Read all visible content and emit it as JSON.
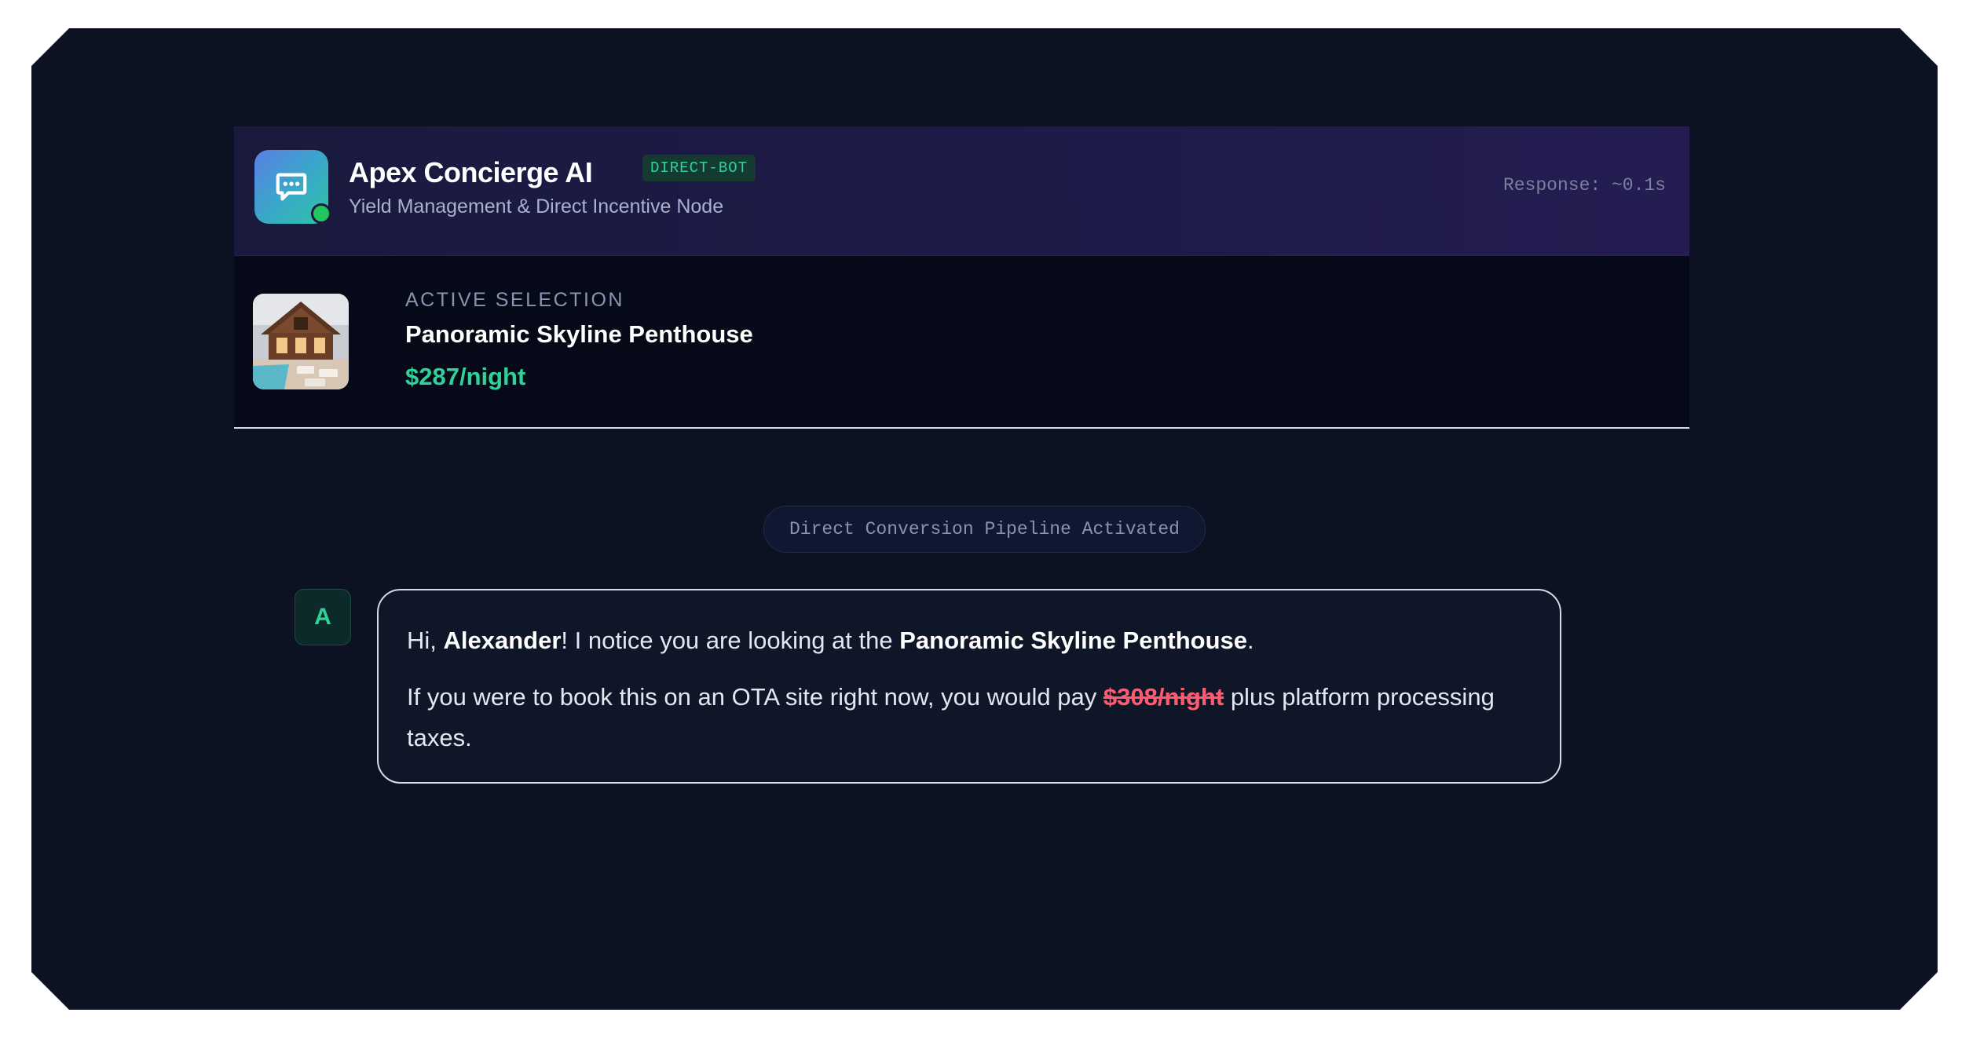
{
  "header": {
    "bot_name": "Apex Concierge AI",
    "badge": "DIRECT-BOT",
    "subtitle": "Yield Management & Direct Incentive Node",
    "response_time": "Response: ~0.1s",
    "status": "online",
    "icon": "chat-bubble-icon"
  },
  "selection": {
    "label": "ACTIVE SELECTION",
    "title": "Panoramic Skyline Penthouse",
    "price": "$287/night",
    "thumbnail": "property-photo"
  },
  "pipeline_label": "Direct Conversion Pipeline Activated",
  "message": {
    "avatar_initial": "A",
    "line1": {
      "prefix": "Hi, ",
      "name": "Alexander",
      "middle": "! I notice you are looking at the ",
      "property": "Panoramic Skyline Penthouse",
      "suffix": "."
    },
    "line2": {
      "prefix": "If you were to book this on an OTA site right now, you would pay ",
      "ota_price": "$308/night",
      "suffix": " plus platform processing taxes."
    }
  },
  "colors": {
    "accent_green": "#2fd39a",
    "strike_red": "#ff5a6e",
    "background": "#0d1223"
  }
}
